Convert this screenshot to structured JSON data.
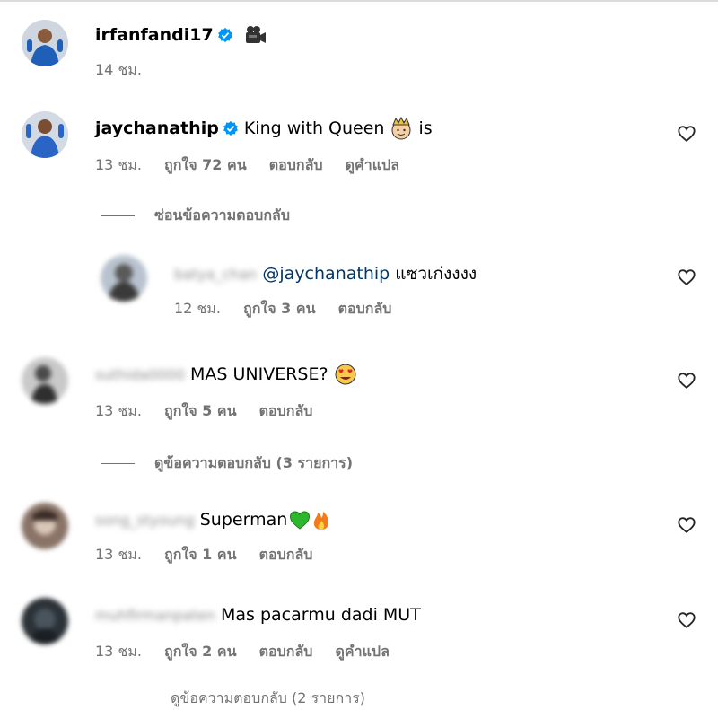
{
  "post": {
    "username": "irfanfandi17",
    "emoji": "movie-camera-emoji",
    "time": "14 ชม."
  },
  "comments": [
    {
      "username": "jaychanathip",
      "verified": true,
      "text": "King with Queen",
      "emoji": "king-crown-emoji",
      "text_after": "is",
      "time": "13 ชม.",
      "likes": "ถูกใจ 72 คน",
      "reply": "ตอบกลับ",
      "translate": "ดูคำแปล",
      "replies_toggle": "ซ่อนข้อความตอบกลับ"
    },
    {
      "username_blurred": "batya_chan",
      "mention": "@jaychanathip",
      "text": "แซวเก่งงงง",
      "time": "12 ชม.",
      "likes": "ถูกใจ 3 คน",
      "reply": "ตอบกลับ"
    },
    {
      "username_blurred": "suthida0000",
      "text": "MAS UNIVERSE?",
      "emoji": "heart-eyes-emoji",
      "time": "13 ชม.",
      "likes": "ถูกใจ 5 คน",
      "reply": "ตอบกลับ",
      "replies_toggle": "ดูข้อความตอบกลับ (3 รายการ)"
    },
    {
      "username_blurred": "song_styoung",
      "text": "Superman",
      "emoji": "green-heart-fire-emoji",
      "time": "13 ชม.",
      "likes": "ถูกใจ 1 คน",
      "reply": "ตอบกลับ"
    },
    {
      "username_blurred": "muhfirmanpaten",
      "text": "Mas pacarmu dadi MUT",
      "time": "13 ชม.",
      "likes": "ถูกใจ 2 คน",
      "reply": "ตอบกลับ",
      "translate": "ดูคำแปล",
      "replies_toggle_cut": "ดูข้อความตอบกลับ (2 รายการ)"
    }
  ],
  "colors": {
    "meta": "#737373",
    "mention": "#00376b",
    "verified": "#0095f6"
  }
}
